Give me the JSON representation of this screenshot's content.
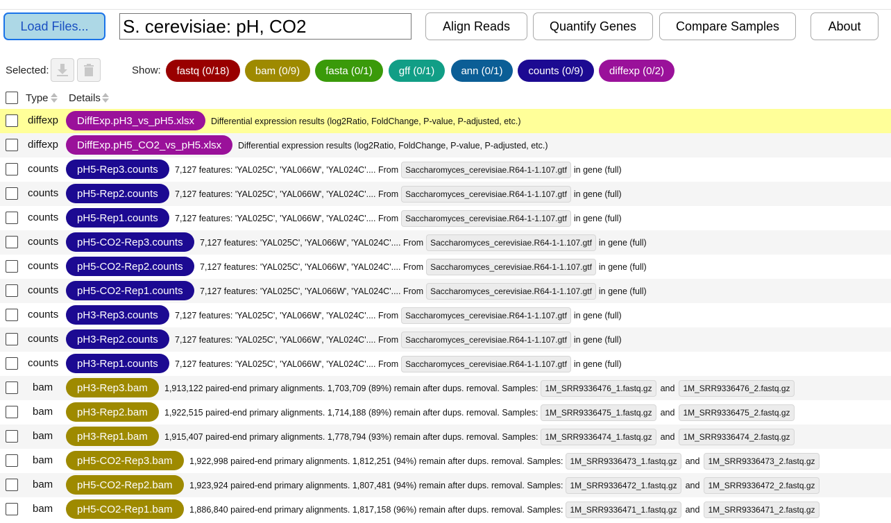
{
  "toolbar": {
    "load_label": "Load Files...",
    "project_title": "S. cerevisiae: pH, CO2",
    "align_label": "Align Reads",
    "quantify_label": "Quantify Genes",
    "compare_label": "Compare Samples",
    "about_label": "About"
  },
  "selection": {
    "selected_label": "Selected:",
    "download_icon": "download-icon",
    "delete_icon": "trash-icon",
    "show_label": "Show:"
  },
  "filters": [
    {
      "label": "fastq (0/18)",
      "color": "#990000"
    },
    {
      "label": "bam (0/9)",
      "color": "#9e8a00"
    },
    {
      "label": "fasta (0/1)",
      "color": "#3a9a0a"
    },
    {
      "label": "gff (0/1)",
      "color": "#119e86"
    },
    {
      "label": "ann (0/1)",
      "color": "#0b5e96"
    },
    {
      "label": "counts (0/9)",
      "color": "#1c0a92"
    },
    {
      "label": "diffexp (0/2)",
      "color": "#9a119a"
    }
  ],
  "table": {
    "col_type": "Type",
    "col_details": "Details"
  },
  "rows": [
    {
      "type": "diffexp",
      "name": "DiffExp.pH3_vs_pH5.xlsx",
      "desc": "Differential expression results (log2Ratio, FoldChange, P-value, P-adjusted, etc.)"
    },
    {
      "type": "diffexp",
      "name": "DiffExp.pH5_CO2_vs_pH5.xlsx",
      "desc": "Differential expression results (log2Ratio, FoldChange, P-value, P-adjusted, etc.)"
    },
    {
      "type": "counts",
      "name": "pH5-Rep3.counts",
      "pre": "7,127 features: 'YAL025C', 'YAL066W', 'YAL024C'.... From",
      "chip1": "Saccharomyces_cerevisiae.R64-1-1.107.gtf",
      "post": "in gene (full)"
    },
    {
      "type": "counts",
      "name": "pH5-Rep2.counts",
      "pre": "7,127 features: 'YAL025C', 'YAL066W', 'YAL024C'.... From",
      "chip1": "Saccharomyces_cerevisiae.R64-1-1.107.gtf",
      "post": "in gene (full)"
    },
    {
      "type": "counts",
      "name": "pH5-Rep1.counts",
      "pre": "7,127 features: 'YAL025C', 'YAL066W', 'YAL024C'.... From",
      "chip1": "Saccharomyces_cerevisiae.R64-1-1.107.gtf",
      "post": "in gene (full)"
    },
    {
      "type": "counts",
      "name": "pH5-CO2-Rep3.counts",
      "pre": "7,127 features: 'YAL025C', 'YAL066W', 'YAL024C'.... From",
      "chip1": "Saccharomyces_cerevisiae.R64-1-1.107.gtf",
      "post": "in gene (full)"
    },
    {
      "type": "counts",
      "name": "pH5-CO2-Rep2.counts",
      "pre": "7,127 features: 'YAL025C', 'YAL066W', 'YAL024C'.... From",
      "chip1": "Saccharomyces_cerevisiae.R64-1-1.107.gtf",
      "post": "in gene (full)"
    },
    {
      "type": "counts",
      "name": "pH5-CO2-Rep1.counts",
      "pre": "7,127 features: 'YAL025C', 'YAL066W', 'YAL024C'.... From",
      "chip1": "Saccharomyces_cerevisiae.R64-1-1.107.gtf",
      "post": "in gene (full)"
    },
    {
      "type": "counts",
      "name": "pH3-Rep3.counts",
      "pre": "7,127 features: 'YAL025C', 'YAL066W', 'YAL024C'.... From",
      "chip1": "Saccharomyces_cerevisiae.R64-1-1.107.gtf",
      "post": "in gene (full)"
    },
    {
      "type": "counts",
      "name": "pH3-Rep2.counts",
      "pre": "7,127 features: 'YAL025C', 'YAL066W', 'YAL024C'.... From",
      "chip1": "Saccharomyces_cerevisiae.R64-1-1.107.gtf",
      "post": "in gene (full)"
    },
    {
      "type": "counts",
      "name": "pH3-Rep1.counts",
      "pre": "7,127 features: 'YAL025C', 'YAL066W', 'YAL024C'.... From",
      "chip1": "Saccharomyces_cerevisiae.R64-1-1.107.gtf",
      "post": "in gene (full)"
    },
    {
      "type": "bam",
      "name": "pH3-Rep3.bam",
      "pre": "1,913,122 paired-end primary alignments. 1,703,709 (89%) remain after dups. removal. Samples:",
      "chip1": "1M_SRR9336476_1.fastq.gz",
      "mid": "and",
      "chip2": "1M_SRR9336476_2.fastq.gz"
    },
    {
      "type": "bam",
      "name": "pH3-Rep2.bam",
      "pre": "1,922,515 paired-end primary alignments. 1,714,188 (89%) remain after dups. removal. Samples:",
      "chip1": "1M_SRR9336475_1.fastq.gz",
      "mid": "and",
      "chip2": "1M_SRR9336475_2.fastq.gz"
    },
    {
      "type": "bam",
      "name": "pH3-Rep1.bam",
      "pre": "1,915,407 paired-end primary alignments. 1,778,794 (93%) remain after dups. removal. Samples:",
      "chip1": "1M_SRR9336474_1.fastq.gz",
      "mid": "and",
      "chip2": "1M_SRR9336474_2.fastq.gz"
    },
    {
      "type": "bam",
      "name": "pH5-CO2-Rep3.bam",
      "pre": "1,922,998 paired-end primary alignments. 1,812,251 (94%) remain after dups. removal. Samples:",
      "chip1": "1M_SRR9336473_1.fastq.gz",
      "mid": "and",
      "chip2": "1M_SRR9336473_2.fastq.gz"
    },
    {
      "type": "bam",
      "name": "pH5-CO2-Rep2.bam",
      "pre": "1,923,924 paired-end primary alignments. 1,807,481 (94%) remain after dups. removal. Samples:",
      "chip1": "1M_SRR9336472_1.fastq.gz",
      "mid": "and",
      "chip2": "1M_SRR9336472_2.fastq.gz"
    },
    {
      "type": "bam",
      "name": "pH5-CO2-Rep1.bam",
      "pre": "1,886,840 paired-end primary alignments. 1,817,158 (96%) remain after dups. removal. Samples:",
      "chip1": "1M_SRR9336471_1.fastq.gz",
      "mid": "and",
      "chip2": "1M_SRR9336471_2.fastq.gz"
    }
  ],
  "colors": {
    "diffexp": "#9a119a",
    "counts": "#1c0a92",
    "bam": "#9e8a00",
    "highlight": "#ffff99"
  }
}
